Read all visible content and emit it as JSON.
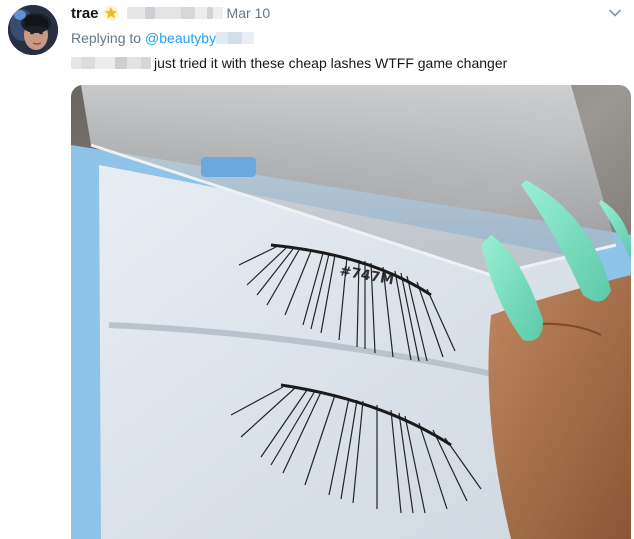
{
  "tweet": {
    "author_name": "trae",
    "date": "Mar 10",
    "replying_to_label": "Replying to",
    "replying_to_handle": "@beautyby",
    "text": "just tried it with these cheap lashes WTFF game changer"
  },
  "photo": {
    "box_label": "#747M",
    "nail_color": "#86e3c8",
    "tray_color": "#8fc3e8"
  },
  "icons": [
    "star-badge-icon",
    "chevron-down-icon"
  ]
}
